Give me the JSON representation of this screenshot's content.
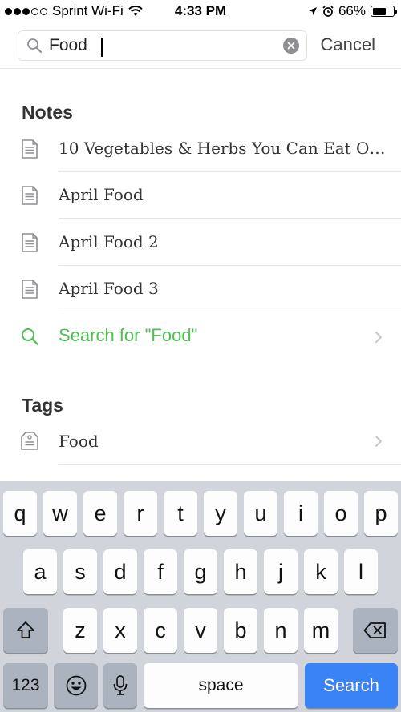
{
  "status_bar": {
    "carrier": "Sprint Wi-Fi",
    "time": "4:33 PM",
    "battery_percent": "66%",
    "battery_level": 0.66
  },
  "search": {
    "query": "Food",
    "cancel_label": "Cancel"
  },
  "notes_section": {
    "title": "Notes",
    "items": [
      {
        "pre": "10 Vegetables & Herbs You Can Eat Onc…",
        "match": "",
        "post": ""
      },
      {
        "pre": "April ",
        "match": "Food",
        "post": ""
      },
      {
        "pre": "April ",
        "match": "Food",
        "post": " 2"
      },
      {
        "pre": "April ",
        "match": "Food",
        "post": " 3"
      }
    ],
    "search_for_label": "Search for \"Food\""
  },
  "tags_section": {
    "title": "Tags",
    "items": [
      {
        "label": "Food"
      }
    ]
  },
  "keyboard": {
    "row1": [
      "q",
      "w",
      "e",
      "r",
      "t",
      "y",
      "u",
      "i",
      "o",
      "p"
    ],
    "row2": [
      "a",
      "s",
      "d",
      "f",
      "g",
      "h",
      "j",
      "k",
      "l"
    ],
    "row3": [
      "z",
      "x",
      "c",
      "v",
      "b",
      "n",
      "m"
    ],
    "numbers_label": "123",
    "space_label": "space",
    "search_label": "Search"
  },
  "colors": {
    "accent_green": "#4fbf52",
    "highlight_underline": "#5fc26a",
    "search_key_blue": "#3a83f6",
    "keyboard_bg": "#d1d5db"
  },
  "icons": {
    "note": "note-icon",
    "tag": "tag-icon",
    "search": "search-icon",
    "chevron": "chevron-right-icon",
    "clear": "clear-icon",
    "shift": "shift-icon",
    "backspace": "backspace-icon",
    "emoji": "emoji-icon",
    "mic": "microphone-icon"
  }
}
